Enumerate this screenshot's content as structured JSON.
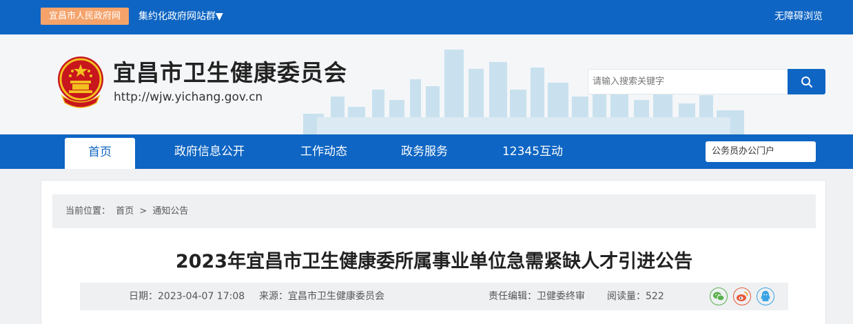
{
  "topbar": {
    "gov_link": "宜昌市人民政府网",
    "site_group": "集约化政府网站群▼",
    "accessible": "无障碍浏览"
  },
  "header": {
    "title": "宜昌市卫生健康委员会",
    "url": "http://wjw.yichang.gov.cn",
    "search_placeholder": "请输入搜索关键字"
  },
  "nav": {
    "items": [
      "首页",
      "政府信息公开",
      "工作动态",
      "政务服务",
      "12345互动"
    ],
    "portal": "公务员办公门户"
  },
  "breadcrumb": {
    "label": "当前位置：",
    "home": "首页",
    "sep": ">",
    "current": "通知公告"
  },
  "article": {
    "title": "2023年宜昌市卫生健康委所属事业单位急需紧缺人才引进公告",
    "date": "日期：2023-04-07 17:08",
    "source": "来源：宜昌市卫生健康委员会",
    "editor": "责任编辑：卫健委终审",
    "views": "阅读量：522"
  },
  "colors": {
    "primary": "#0e65c3",
    "gov_link_bg": "#f5a36b",
    "wechat": "#5bb04f",
    "weibo": "#e8593b",
    "qq": "#3aa3e3"
  },
  "share_icons": [
    "wechat-icon",
    "weibo-icon",
    "qq-icon"
  ]
}
